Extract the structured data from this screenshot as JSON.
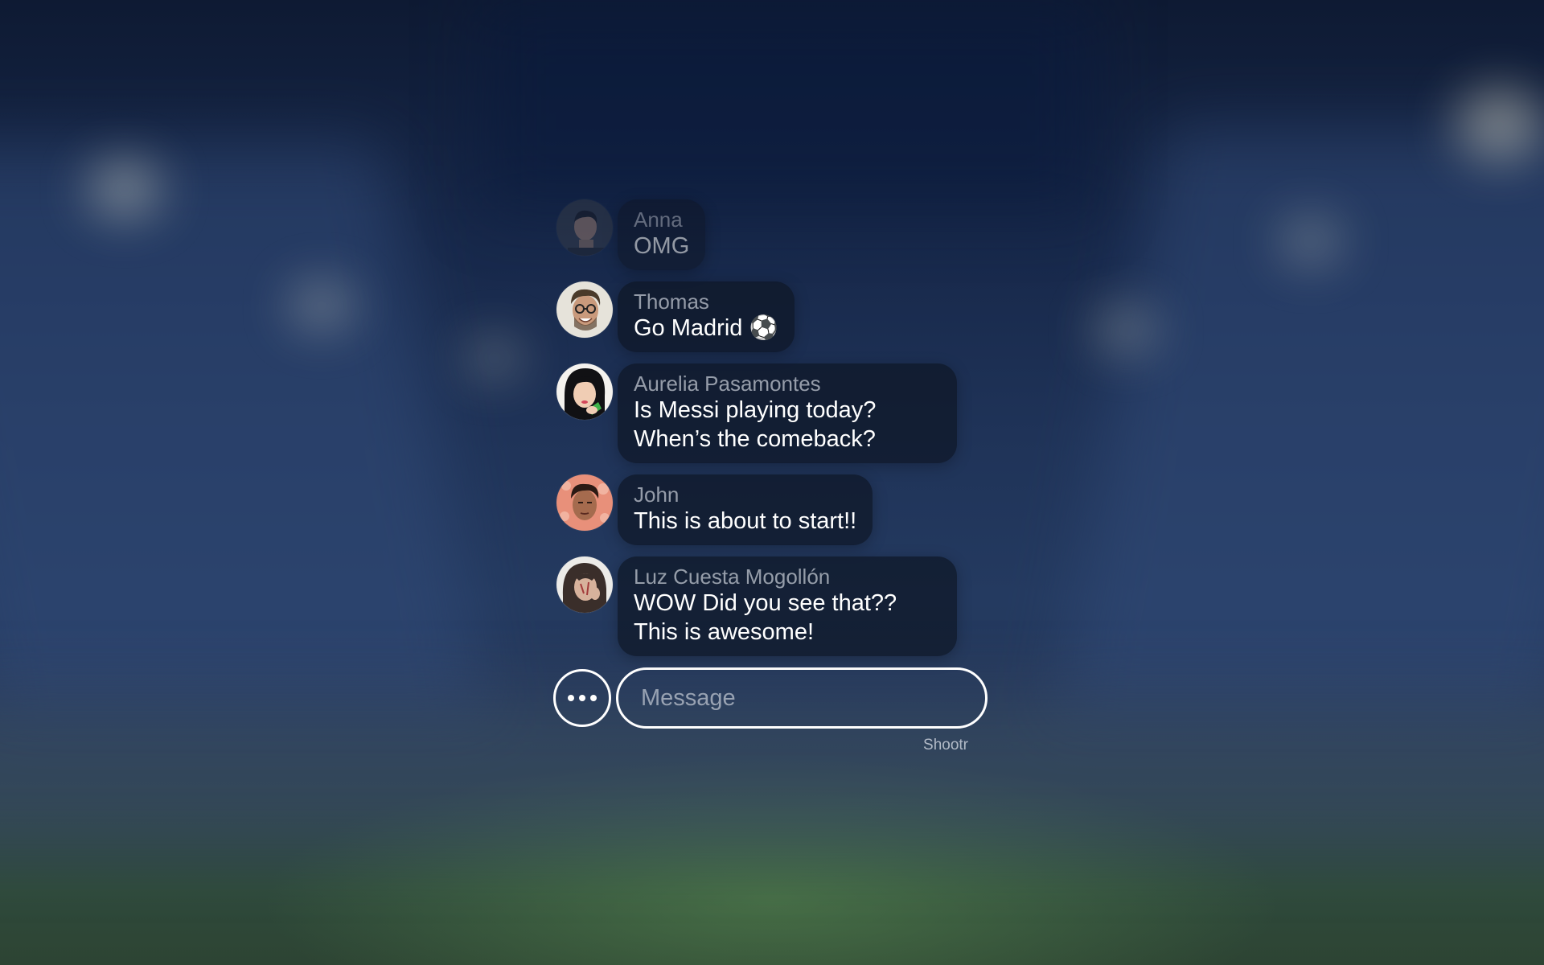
{
  "messages": [
    {
      "sender": "Anna",
      "text": "OMG",
      "avatar_icon": "avatar-anna"
    },
    {
      "sender": "Thomas",
      "text": "Go Madrid ⚽",
      "avatar_icon": "avatar-thomas"
    },
    {
      "sender": "Aurelia Pasamontes",
      "text": "Is Messi playing today? When’s the comeback?",
      "avatar_icon": "avatar-aurelia"
    },
    {
      "sender": "John",
      "text": "This is about to start!!",
      "avatar_icon": "avatar-john"
    },
    {
      "sender": "Luz Cuesta Mogollón",
      "text": "WOW Did you see that?? This is awesome!",
      "avatar_icon": "avatar-luz"
    }
  ],
  "composer": {
    "placeholder": "Message",
    "more_icon": "more-horizontal-icon"
  },
  "branding": {
    "label": "Shootr"
  },
  "colors": {
    "bubble_bg": "#0e1626",
    "text": "#ffffff",
    "sender": "#c8cdd7",
    "background_top": "#0e1a33",
    "background_field": "#2f4a3c"
  }
}
